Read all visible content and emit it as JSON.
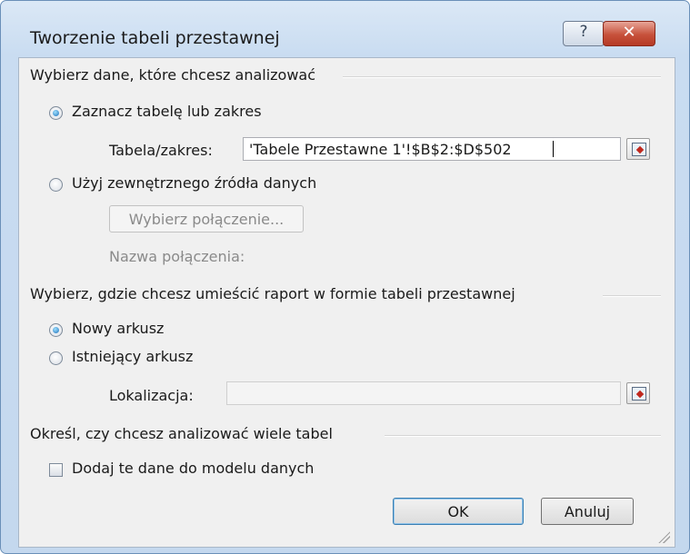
{
  "window": {
    "title": "Tworzenie tabeli przestawnej",
    "help_glyph": "?",
    "close_glyph": "✕"
  },
  "section_data": {
    "heading": "Wybierz dane, które chcesz analizować",
    "radio_table": "Zaznacz tabelę lub zakres",
    "range_label": "Tabela/zakres:",
    "range_value": "'Tabele Przestawne 1'!$B$2:$D$502",
    "radio_external": "Użyj zewnętrznego źródła danych",
    "choose_connection_button": "Wybierz połączenie...",
    "connection_name_label": "Nazwa połączenia:"
  },
  "section_location": {
    "heading": "Wybierz, gdzie chcesz umieścić raport w formie tabeli przestawnej",
    "radio_new": "Nowy arkusz",
    "radio_existing": "Istniejący arkusz",
    "location_label": "Lokalizacja:",
    "location_value": ""
  },
  "section_multi": {
    "heading": "Określ, czy chcesz analizować wiele tabel",
    "checkbox_label": "Dodaj te dane do modelu danych"
  },
  "buttons": {
    "ok": "OK",
    "cancel": "Anuluj"
  }
}
